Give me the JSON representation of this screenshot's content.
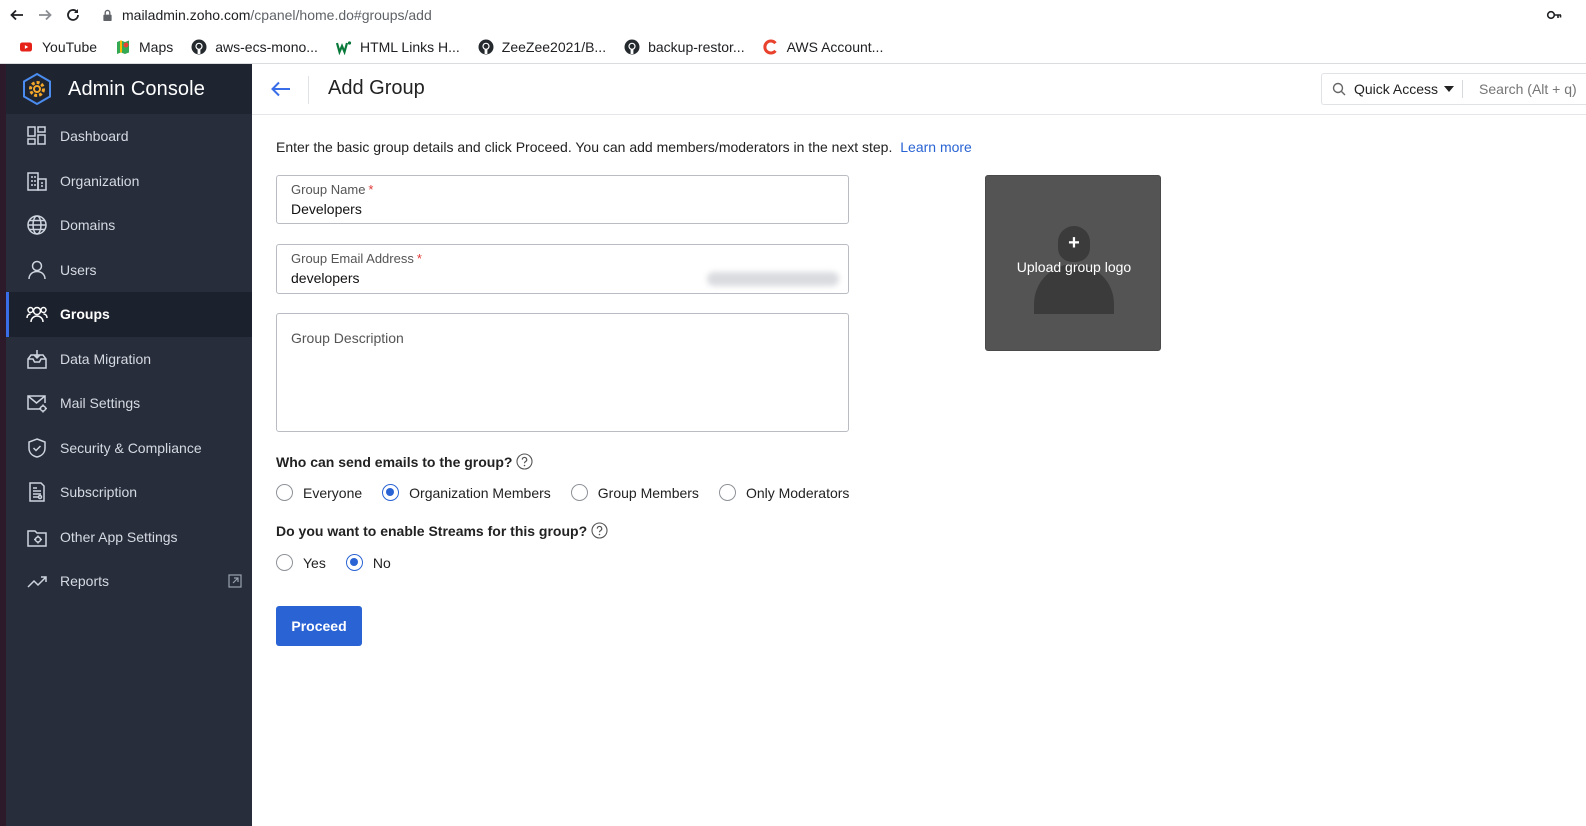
{
  "browser": {
    "url_host": "mailadmin.zoho.com",
    "url_path": "/cpanel/home.do#groups/add",
    "bookmarks": [
      {
        "label": "YouTube",
        "icon": "youtube-icon"
      },
      {
        "label": "Maps",
        "icon": "maps-icon"
      },
      {
        "label": "aws-ecs-mono...",
        "icon": "github-icon"
      },
      {
        "label": "HTML Links H...",
        "icon": "w-icon"
      },
      {
        "label": "ZeeZee2021/B...",
        "icon": "github-icon"
      },
      {
        "label": "backup-restor...",
        "icon": "github-icon"
      },
      {
        "label": "AWS Account...",
        "icon": "c-icon"
      }
    ]
  },
  "sidebar": {
    "title": "Admin Console",
    "items": [
      {
        "label": "Dashboard",
        "icon": "dashboard-icon"
      },
      {
        "label": "Organization",
        "icon": "organization-icon"
      },
      {
        "label": "Domains",
        "icon": "globe-icon"
      },
      {
        "label": "Users",
        "icon": "user-icon"
      },
      {
        "label": "Groups",
        "icon": "groups-icon",
        "active": true
      },
      {
        "label": "Data Migration",
        "icon": "data-migration-icon"
      },
      {
        "label": "Mail Settings",
        "icon": "mail-settings-icon"
      },
      {
        "label": "Security & Compliance",
        "icon": "shield-icon"
      },
      {
        "label": "Subscription",
        "icon": "subscription-icon"
      },
      {
        "label": "Other App Settings",
        "icon": "app-settings-icon"
      },
      {
        "label": "Reports",
        "icon": "reports-icon"
      }
    ]
  },
  "header": {
    "title": "Add Group",
    "quick_access": "Quick Access",
    "search_placeholder": "Search (Alt + q)"
  },
  "form": {
    "intro": "Enter the basic group details and click Proceed. You can add members/moderators in the next step.",
    "learn_more": "Learn more",
    "group_name_label": "Group Name",
    "group_name_value": "Developers",
    "email_label": "Group Email Address",
    "email_value": "developers",
    "description_label": "Group Description",
    "required_mark": "*",
    "upload_plus": "+",
    "upload_text": "Upload group logo",
    "q_send": "Who can send emails to the group?",
    "send_options": [
      "Everyone",
      "Organization Members",
      "Group Members",
      "Only Moderators"
    ],
    "send_selected": "Organization Members",
    "q_streams": "Do you want to enable Streams for this group?",
    "streams_options": [
      "Yes",
      "No"
    ],
    "streams_selected": "No",
    "proceed_label": "Proceed"
  },
  "colors": {
    "sidebar_bg": "#272d3a",
    "accent": "#2a64d4",
    "upload_bg": "#545454"
  }
}
